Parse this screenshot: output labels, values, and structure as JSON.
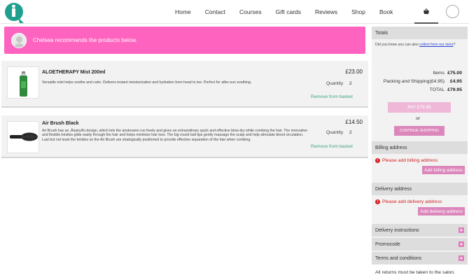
{
  "header": {
    "nav": [
      "Home",
      "Contact",
      "Courses",
      "Gift cards",
      "Reviews",
      "Shop",
      "Book"
    ],
    "basket_icon": "basket-icon",
    "account_icon": "account-icon",
    "logo_color": "#1fa08f"
  },
  "banner": {
    "text": "Chelsea recommends the products below.",
    "color": "#ff63c0"
  },
  "products": [
    {
      "name": "ALOETHERAPY Mist 200ml",
      "description": "Versatile mist helps soothe and calm. Delivers instant moisturization and hydration from head to toe. Perfect for after-sun soothing.",
      "price": "£23.00",
      "quantity_label": "Quantity",
      "quantity": "2",
      "remove_label": "Remove from basket"
    },
    {
      "name": "Air Brush Black",
      "description": "Air Brush has an ‚ÄúairyÄù design, which lets the airstreams run freely and gives an extraordinary quick and effective blow-dry while combing the hair. The innovative and flexible bristles glide easily through the hair and helps minimize hair loss. The big round ball tips gently massage the scalp and help stimulate blood circulation. Last but not least the bristles on the Air Brush are strategically positioned to provide effective separation of the hair when combing.",
      "price": "£14.50",
      "quantity_label": "Quantity",
      "quantity": "2",
      "remove_label": "Remove from basket"
    }
  ],
  "sidebar": {
    "totals_title": "Totals",
    "collect_prefix": "Did you know you can also ",
    "collect_link": "collect from our store",
    "collect_suffix": "?",
    "items_label": "Items",
    "items_value": "£75.00",
    "shipping_label": "Packing and Shipping(£4.95)",
    "shipping_value": "£4.95",
    "total_label": "TOTAL",
    "total_value": "£79.95",
    "pay_label": "PAY £79.95",
    "or_label": "or",
    "continue_label": "CONTINUE SHOPPING",
    "billing_title": "Billing address",
    "billing_error": "Please add billing address",
    "billing_button": "Add billing address",
    "delivery_title": "Delivery address",
    "delivery_error": "Please add delivery address",
    "delivery_button": "Add delivery address",
    "instructions_title": "Delivery instructions",
    "promocode_title": "Promocode",
    "terms_title": "Terms and conditions",
    "returns_text": "All returns must be taken to the salon."
  }
}
